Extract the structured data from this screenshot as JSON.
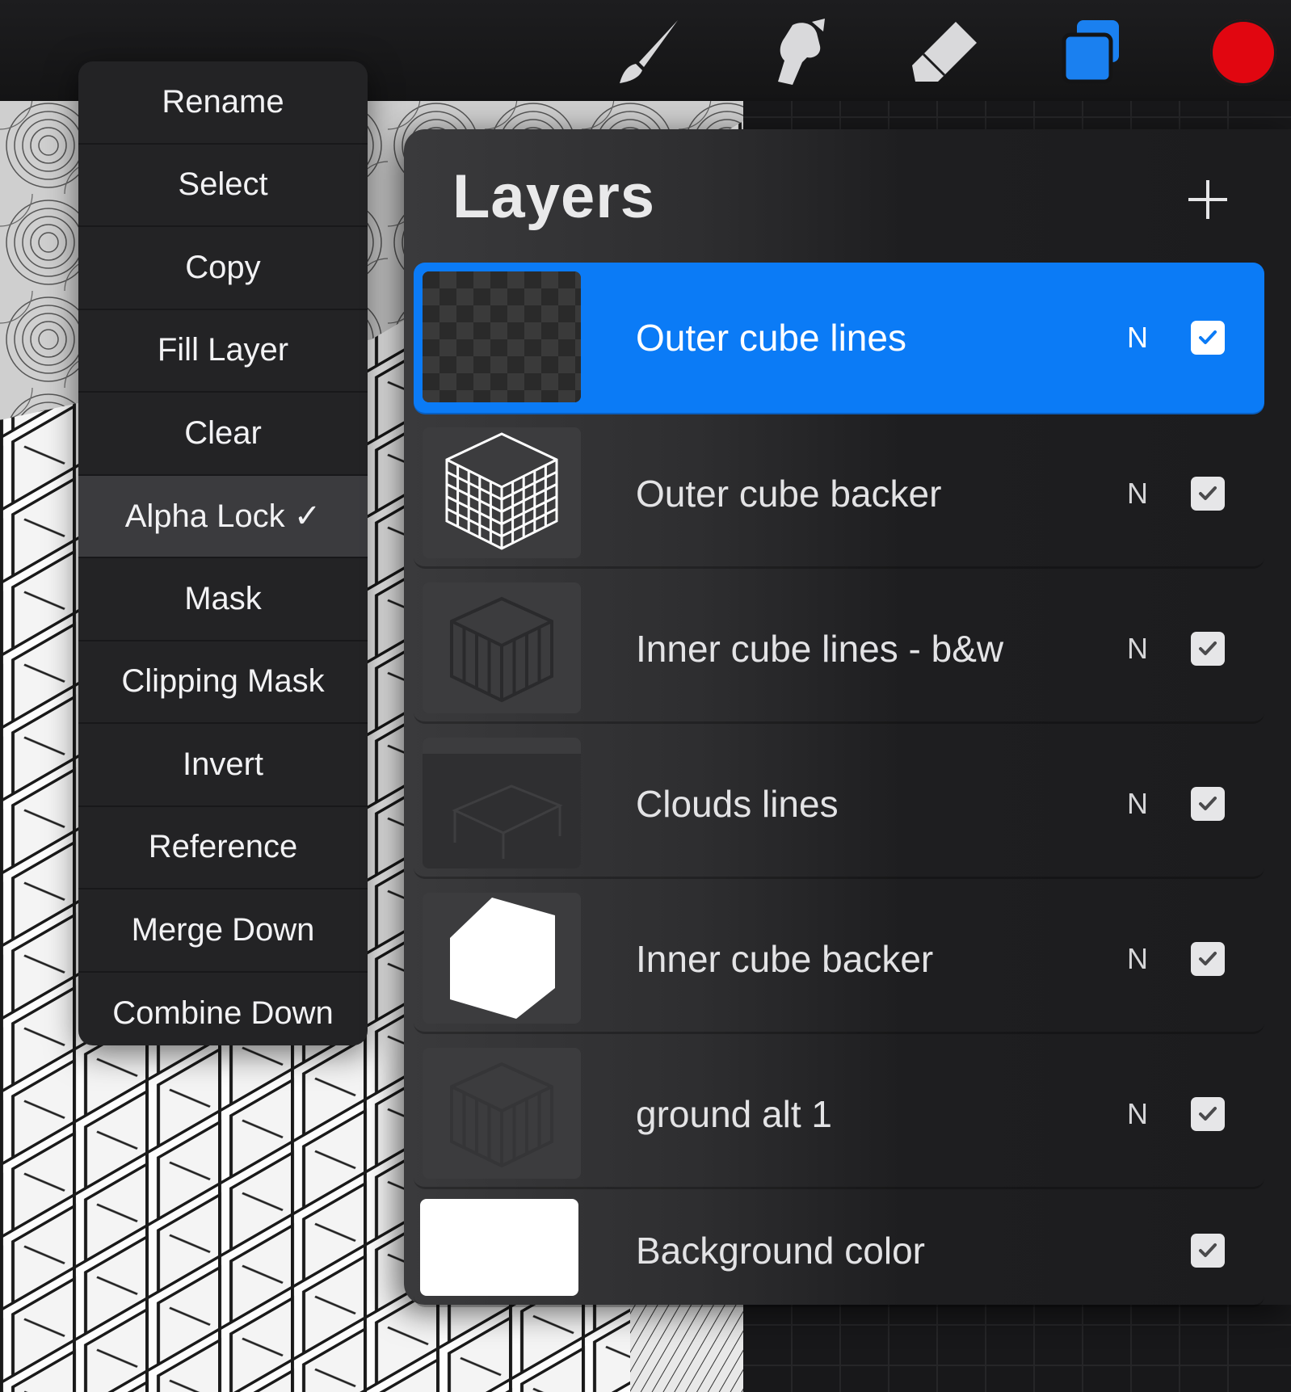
{
  "toolbar": {
    "tools": [
      {
        "name": "paintbrush-icon",
        "active": false
      },
      {
        "name": "smudge-icon",
        "active": false
      },
      {
        "name": "eraser-icon",
        "active": false
      },
      {
        "name": "layers-icon",
        "active": true
      }
    ],
    "current_color": "#e10610",
    "active_tool_color": "#1a80f0"
  },
  "layer_menu": {
    "items": [
      {
        "label": "Rename"
      },
      {
        "label": "Select"
      },
      {
        "label": "Copy"
      },
      {
        "label": "Fill Layer"
      },
      {
        "label": "Clear"
      },
      {
        "label": "Alpha Lock ✓",
        "active": true
      },
      {
        "label": "Mask"
      },
      {
        "label": "Clipping Mask"
      },
      {
        "label": "Invert"
      },
      {
        "label": "Reference"
      },
      {
        "label": "Merge Down"
      },
      {
        "label": "Combine Down"
      }
    ]
  },
  "layers_panel": {
    "title": "Layers",
    "add_icon": "plus-icon",
    "selected_color": "#0b7bf6",
    "layers": [
      {
        "name": "Outer cube lines",
        "blend": "N",
        "visible": true,
        "selected": true,
        "thumb": "checker"
      },
      {
        "name": "Outer cube backer",
        "blend": "N",
        "visible": true,
        "selected": false,
        "thumb": "lattice"
      },
      {
        "name": "Inner cube lines - b&w",
        "blend": "N",
        "visible": true,
        "selected": false,
        "thumb": "dark-lattice"
      },
      {
        "name": "Clouds lines",
        "blend": "N",
        "visible": true,
        "selected": false,
        "thumb": "clouds"
      },
      {
        "name": "Inner cube backer",
        "blend": "N",
        "visible": true,
        "selected": false,
        "thumb": "hexagon"
      },
      {
        "name": "ground alt 1",
        "blend": "N",
        "visible": true,
        "selected": false,
        "thumb": "faint-lattice"
      },
      {
        "name": "Background color",
        "blend": "",
        "visible": true,
        "selected": false,
        "thumb": "white"
      }
    ]
  }
}
